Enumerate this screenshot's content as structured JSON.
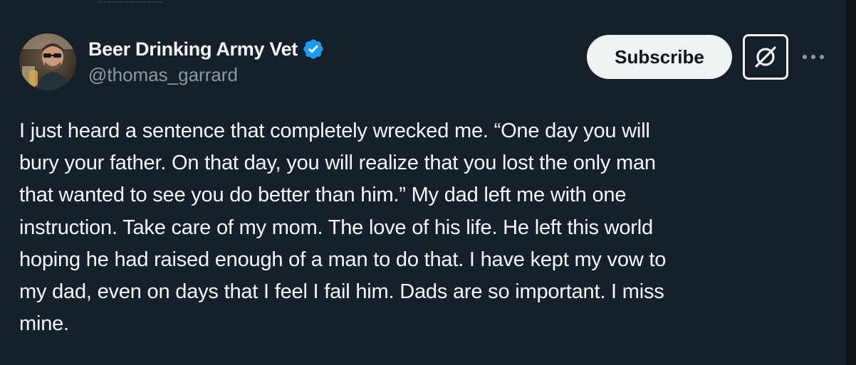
{
  "author": {
    "display_name": "Beer Drinking Army Vet",
    "handle": "@thomas_garrard",
    "verified": true,
    "verified_color": "#1d9bf0"
  },
  "actions": {
    "subscribe_label": "Subscribe",
    "grok_icon": "grok-icon",
    "more_icon": "more-horizontal-icon"
  },
  "tweet": {
    "lines": [
      "I just heard a sentence that completely wrecked me. “One day you will",
      "bury your father. On that day, you will realize that you lost the only man",
      "that wanted to see you do better than him.” My dad left me with one",
      "instruction. Take care of my mom. The love of his life. He left this world",
      "hoping he had raised enough of a man to do that. I have kept my vow to",
      "my dad, even on days that I feel I fail him. Dads are so important. I miss",
      "mine."
    ]
  },
  "colors": {
    "background": "#15202b",
    "text_primary": "#f7f9f9",
    "text_secondary": "#8b98a5",
    "button_bg": "#eff3f4"
  }
}
